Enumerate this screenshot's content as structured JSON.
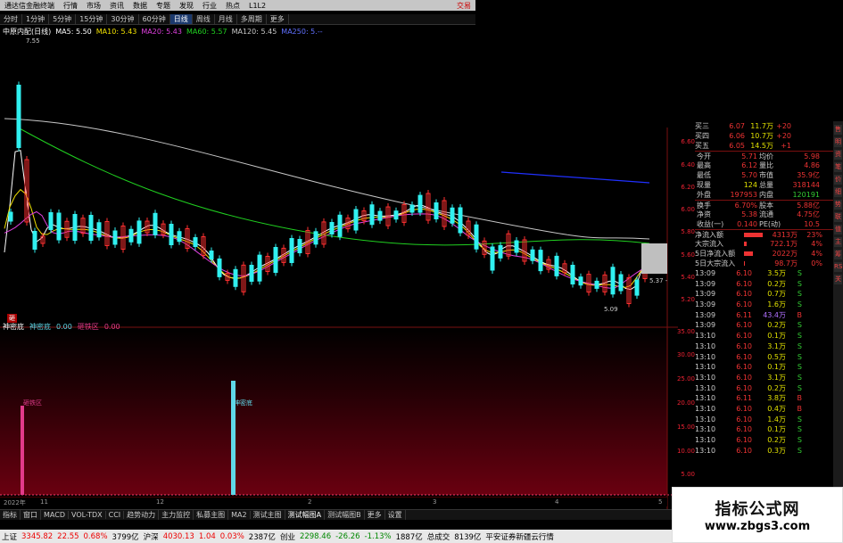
{
  "app": {
    "title": "通达信金融终端",
    "title_right": "交易",
    "menu": [
      "行情",
      "市场",
      "资讯",
      "数据",
      "专题",
      "发现",
      "行业",
      "热点",
      "L1L2"
    ]
  },
  "periods": {
    "items": [
      "分时",
      "1分钟",
      "5分钟",
      "15分钟",
      "30分钟",
      "60分钟",
      "日线",
      "周线",
      "月线",
      "多周期",
      "更多"
    ],
    "active": "日线"
  },
  "ma_line": {
    "stock_name": "中原内配(日线)",
    "ma5": "MA5: 5.50",
    "ma10": "MA10: 5.43",
    "ma20": "MA20: 5.43",
    "ma60": "MA60: 5.57",
    "ma120": "MA120: 5.45",
    "ma250": "MA250: 5.--",
    "colors": {
      "ma5": "#ffffff",
      "ma10": "#f0e000",
      "ma20": "#e040e0",
      "ma60": "#20d020",
      "ma120": "#c8c8c8",
      "ma250": "#2030ff",
      "up": "#ff3030",
      "down": "#30f0f0"
    }
  },
  "price_labels": {
    "high": "7.55",
    "low": "5.09",
    "current": "5.37 - 5"
  },
  "price_axis": [
    "6.60",
    "6.40",
    "6.20",
    "6.00",
    "5.80",
    "5.60",
    "5.40",
    "5.20"
  ],
  "indicator": {
    "name": "神密底",
    "value1_label": "神密底",
    "value1": "0.00",
    "value2_label": "砸铁区",
    "value2": "0.00",
    "badge": "砸",
    "bar1_label": "砸铁区",
    "bar2_label": "神密底",
    "axis": [
      "35.00",
      "30.00",
      "25.00",
      "20.00",
      "15.00",
      "10.00",
      "5.00"
    ]
  },
  "date_axis": {
    "year_label": "2022年",
    "ticks": [
      "11",
      "12",
      "2",
      "3",
      "4",
      "5"
    ]
  },
  "order_book": [
    {
      "label": "买三",
      "price": "6.07",
      "vol": "11.7万",
      "extra": "+20"
    },
    {
      "label": "买四",
      "price": "6.06",
      "vol": "10.7万",
      "extra": "+20"
    },
    {
      "label": "买五",
      "price": "6.05",
      "vol": "14.5万",
      "extra": "+1"
    }
  ],
  "quote_stats": [
    {
      "l1": "今开",
      "v1": "5.71",
      "l2": "均价",
      "v2": "5.98"
    },
    {
      "l1": "最高",
      "v1": "6.12",
      "l2": "量比",
      "v2": "4.86"
    },
    {
      "l1": "最低",
      "v1": "5.70",
      "l2": "市值",
      "v2": "35.9亿"
    },
    {
      "l1": "现量",
      "v1": "124",
      "l2": "总量",
      "v2": "318144"
    },
    {
      "l1": "外盘",
      "v1": "197953",
      "l2": "内盘",
      "v2": "120191"
    },
    {
      "l1": "换手",
      "v1": "6.70%",
      "l2": "股本",
      "v2": "5.88亿"
    },
    {
      "l1": "净资",
      "v1": "5.38",
      "l2": "流通",
      "v2": "4.75亿"
    },
    {
      "l1": "收益(一)",
      "v1": "0.140",
      "l2": "PE(动)",
      "v2": "10.5"
    }
  ],
  "flow": [
    {
      "label": "净流入额",
      "value": "4313万",
      "pct": "23%",
      "fill": 0.95
    },
    {
      "label": "大宗流入",
      "value": "722.1万",
      "pct": "4%",
      "fill": 0.12
    },
    {
      "label": "5日净流入额",
      "value": "2022万",
      "pct": "4%",
      "fill": 0.45
    },
    {
      "label": "5日大宗流入",
      "value": "98.7万",
      "pct": "0%",
      "fill": 0.02
    }
  ],
  "ticks": [
    {
      "t": "13:09",
      "p": "6.10",
      "v": "3.5万",
      "s": "S"
    },
    {
      "t": "13:09",
      "p": "6.10",
      "v": "0.2万",
      "s": "S"
    },
    {
      "t": "13:09",
      "p": "6.10",
      "v": "0.7万",
      "s": "S"
    },
    {
      "t": "13:09",
      "p": "6.10",
      "v": "1.6万",
      "s": "S"
    },
    {
      "t": "13:09",
      "p": "6.11",
      "v": "43.4万",
      "s": "B"
    },
    {
      "t": "13:09",
      "p": "6.10",
      "v": "0.2万",
      "s": "S"
    },
    {
      "t": "13:10",
      "p": "6.10",
      "v": "0.1万",
      "s": "S"
    },
    {
      "t": "13:10",
      "p": "6.10",
      "v": "3.1万",
      "s": "S"
    },
    {
      "t": "13:10",
      "p": "6.10",
      "v": "0.5万",
      "s": "S"
    },
    {
      "t": "13:10",
      "p": "6.10",
      "v": "0.1万",
      "s": "S"
    },
    {
      "t": "13:10",
      "p": "6.10",
      "v": "3.1万",
      "s": "S"
    },
    {
      "t": "13:10",
      "p": "6.10",
      "v": "0.2万",
      "s": "S"
    },
    {
      "t": "13:10",
      "p": "6.11",
      "v": "3.8万",
      "s": "B"
    },
    {
      "t": "13:10",
      "p": "6.10",
      "v": "0.4万",
      "s": "B"
    },
    {
      "t": "13:10",
      "p": "6.10",
      "v": "1.4万",
      "s": "S"
    },
    {
      "t": "13:10",
      "p": "6.10",
      "v": "0.1万",
      "s": "S"
    },
    {
      "t": "13:10",
      "p": "6.10",
      "v": "0.2万",
      "s": "S"
    },
    {
      "t": "13:10",
      "p": "6.10",
      "v": "0.3万",
      "s": "S"
    }
  ],
  "side_icons": [
    "售",
    "明",
    "资",
    "笔",
    "价",
    "细",
    "势",
    "联",
    "值",
    "主",
    "筹",
    "RSI",
    "关"
  ],
  "tabs": {
    "items": [
      "指标",
      "窗口",
      "MACD",
      "VOL-TDX",
      "CCI",
      "趋势动力",
      "主力监控",
      "私募主图",
      "MA2",
      "测试主图",
      "测试幅图A",
      "测试幅图B",
      "更多",
      "设置"
    ],
    "active": "测试幅图A"
  },
  "status": {
    "sh_label": "上证",
    "sh_val": "3345.82",
    "sh_chg": "22.55",
    "sh_pct": "0.68%",
    "sh_amt": "3799亿",
    "hs_label": "沪深",
    "hs_val": "4030.13",
    "hs_chg": "1.04",
    "hs_pct": "0.03%",
    "hs_amt": "2387亿",
    "cy_label": "创业",
    "cy_val": "2298.46",
    "cy_chg": "-26.26",
    "cy_pct": "-1.13%",
    "cy_amt": "1887亿",
    "total_label": "总成交",
    "total_amt": "8139亿",
    "broker": "平安证券新疆云行情"
  },
  "watermark": {
    "title": "指标公式网",
    "url": "www.zbgs3.com"
  }
}
